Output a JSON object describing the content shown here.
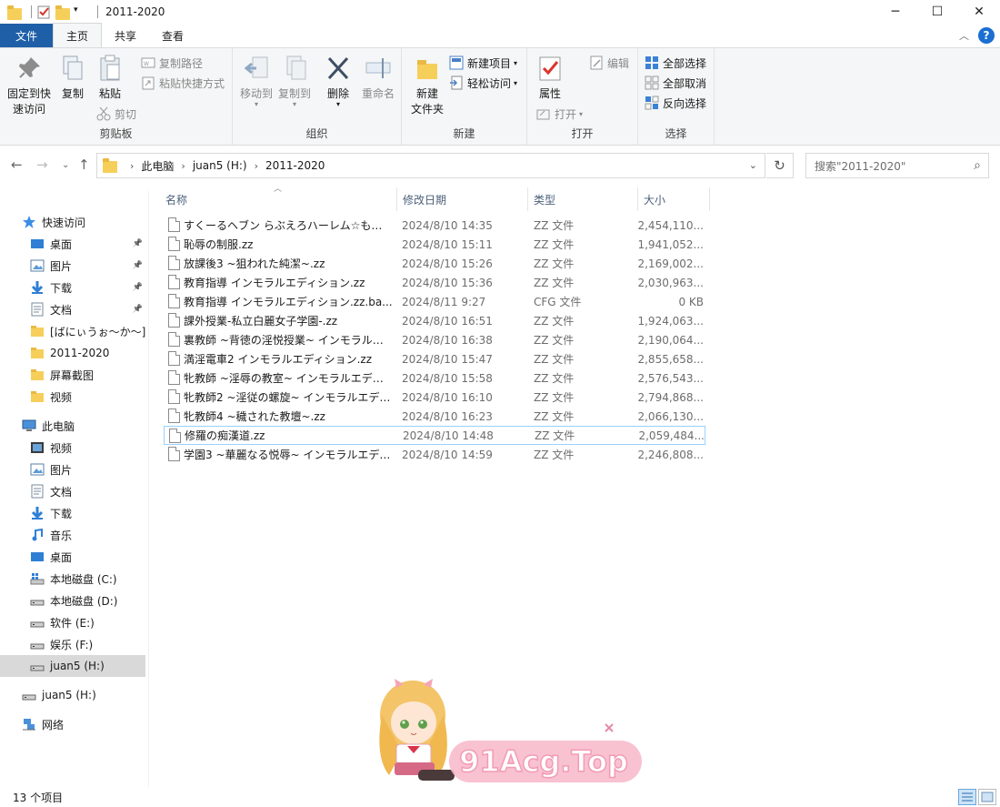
{
  "window": {
    "title": "2011-2020",
    "min": "─",
    "max": "☐",
    "close": "✕"
  },
  "tabs": [
    "文件",
    "主页",
    "共享",
    "查看"
  ],
  "ribbon": {
    "clipboard": {
      "pin": "固定到快\n速访问",
      "copy": "复制",
      "paste": "粘贴",
      "copy_path": "复制路径",
      "paste_shortcut": "粘贴快捷方式",
      "cut": "剪切",
      "label": "剪贴板"
    },
    "organize": {
      "move_to": "移动到",
      "copy_to": "复制到",
      "delete": "删除",
      "rename": "重命名",
      "label": "组织"
    },
    "new": {
      "new_folder": "新建\n文件夹",
      "new_item": "新建项目",
      "easy_access": "轻松访问",
      "label": "新建"
    },
    "open": {
      "properties": "属性",
      "open": "打开",
      "edit": "编辑",
      "label": "打开"
    },
    "select": {
      "select_all": "全部选择",
      "select_none": "全部取消",
      "invert": "反向选择",
      "label": "选择"
    }
  },
  "address": {
    "crumbs": [
      "此电脑",
      "juan5 (H:)",
      "2011-2020"
    ],
    "search_placeholder": "搜索\"2011-2020\""
  },
  "sidebar": {
    "items": [
      {
        "label": "快速访问",
        "icon": "star-icon",
        "indent": 0,
        "pinned": false
      },
      {
        "label": "桌面",
        "icon": "desktop-icon",
        "indent": 1,
        "pinned": true
      },
      {
        "label": "图片",
        "icon": "pictures-icon",
        "indent": 1,
        "pinned": true
      },
      {
        "label": "下载",
        "icon": "download-icon",
        "indent": 1,
        "pinned": true
      },
      {
        "label": "文档",
        "icon": "documents-icon",
        "indent": 1,
        "pinned": true
      },
      {
        "label": "[ばにぃうぉ～か～]C",
        "icon": "folder-icon",
        "indent": 1,
        "pinned": false
      },
      {
        "label": "2011-2020",
        "icon": "folder-icon",
        "indent": 1,
        "pinned": false
      },
      {
        "label": "屏幕截图",
        "icon": "folder-icon",
        "indent": 1,
        "pinned": false
      },
      {
        "label": "视频",
        "icon": "folder-icon",
        "indent": 1,
        "pinned": false
      },
      {
        "label": "此电脑",
        "icon": "computer-icon",
        "indent": 0,
        "pinned": false
      },
      {
        "label": "视频",
        "icon": "videos-icon",
        "indent": 1,
        "pinned": false
      },
      {
        "label": "图片",
        "icon": "pictures-icon",
        "indent": 1,
        "pinned": false
      },
      {
        "label": "文档",
        "icon": "documents-icon",
        "indent": 1,
        "pinned": false
      },
      {
        "label": "下载",
        "icon": "download-icon",
        "indent": 1,
        "pinned": false
      },
      {
        "label": "音乐",
        "icon": "music-icon",
        "indent": 1,
        "pinned": false
      },
      {
        "label": "桌面",
        "icon": "desktop-icon",
        "indent": 1,
        "pinned": false
      },
      {
        "label": "本地磁盘 (C:)",
        "icon": "system-drive-icon",
        "indent": 1,
        "pinned": false
      },
      {
        "label": "本地磁盘 (D:)",
        "icon": "drive-icon",
        "indent": 1,
        "pinned": false
      },
      {
        "label": "软件 (E:)",
        "icon": "drive-icon",
        "indent": 1,
        "pinned": false
      },
      {
        "label": "娱乐 (F:)",
        "icon": "drive-icon",
        "indent": 1,
        "pinned": false
      },
      {
        "label": "juan5 (H:)",
        "icon": "drive-icon",
        "indent": 1,
        "pinned": false,
        "selected": true
      },
      {
        "label": "juan5 (H:)",
        "icon": "drive-icon",
        "indent": 0,
        "pinned": false
      },
      {
        "label": "网络",
        "icon": "network-icon",
        "indent": 0,
        "pinned": false
      }
    ]
  },
  "list": {
    "columns": [
      "名称",
      "修改日期",
      "类型",
      "大小"
    ],
    "rows": [
      {
        "name": "すくーるヘブン らぶえろハーレム☆も…",
        "date": "2024/8/10 14:35",
        "type": "ZZ 文件",
        "size": "2,454,110..."
      },
      {
        "name": "恥辱の制服.zz",
        "date": "2024/8/10 15:11",
        "type": "ZZ 文件",
        "size": "1,941,052..."
      },
      {
        "name": "放課後3 ~狙われた純潔~.zz",
        "date": "2024/8/10 15:26",
        "type": "ZZ 文件",
        "size": "2,169,002..."
      },
      {
        "name": "教育指導 インモラルエディション.zz",
        "date": "2024/8/10 15:36",
        "type": "ZZ 文件",
        "size": "2,030,963..."
      },
      {
        "name": "教育指導 インモラルエディション.zz.ba...",
        "date": "2024/8/11 9:27",
        "type": "CFG 文件",
        "size": "0 KB"
      },
      {
        "name": "課外授業-私立白麗女子学園-.zz",
        "date": "2024/8/10 16:51",
        "type": "ZZ 文件",
        "size": "1,924,063..."
      },
      {
        "name": "裏教師 ~背徳の淫悦授業~ インモラル…",
        "date": "2024/8/10 16:38",
        "type": "ZZ 文件",
        "size": "2,190,064..."
      },
      {
        "name": "満淫電車2 インモラルエディション.zz",
        "date": "2024/8/10 15:47",
        "type": "ZZ 文件",
        "size": "2,855,658..."
      },
      {
        "name": "牝教師 ~淫辱の教室~ インモラルエデ…",
        "date": "2024/8/10 15:58",
        "type": "ZZ 文件",
        "size": "2,576,543..."
      },
      {
        "name": "牝教師2 ~淫従の螺旋~ インモラルエデ…",
        "date": "2024/8/10 16:10",
        "type": "ZZ 文件",
        "size": "2,794,868..."
      },
      {
        "name": "牝教師4 ~穢された教壇~.zz",
        "date": "2024/8/10 16:23",
        "type": "ZZ 文件",
        "size": "2,066,130..."
      },
      {
        "name": "修羅の痴漢道.zz",
        "date": "2024/8/10 14:48",
        "type": "ZZ 文件",
        "size": "2,059,484...",
        "focused": true
      },
      {
        "name": "学園3 ~華麗なる悦辱~ インモラルエデ…",
        "date": "2024/8/10 14:59",
        "type": "ZZ 文件",
        "size": "2,246,808..."
      }
    ]
  },
  "status": {
    "count": "13 个项目"
  },
  "watermark": {
    "text": "91Acg.Top"
  }
}
